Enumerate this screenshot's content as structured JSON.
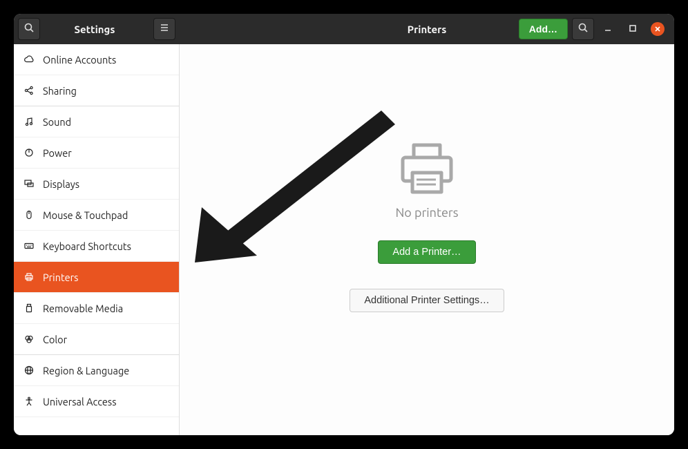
{
  "titlebar": {
    "sidebar_title": "Settings",
    "main_title": "Printers",
    "add_label": "Add…"
  },
  "sidebar": {
    "items": [
      {
        "id": "online-accounts",
        "label": "Online Accounts",
        "selected": false
      },
      {
        "id": "sharing",
        "label": "Sharing",
        "selected": false
      },
      {
        "id": "sound",
        "label": "Sound",
        "selected": false
      },
      {
        "id": "power",
        "label": "Power",
        "selected": false
      },
      {
        "id": "displays",
        "label": "Displays",
        "selected": false
      },
      {
        "id": "mouse-touchpad",
        "label": "Mouse & Touchpad",
        "selected": false
      },
      {
        "id": "keyboard-shortcuts",
        "label": "Keyboard Shortcuts",
        "selected": false
      },
      {
        "id": "printers",
        "label": "Printers",
        "selected": true
      },
      {
        "id": "removable-media",
        "label": "Removable Media",
        "selected": false
      },
      {
        "id": "color",
        "label": "Color",
        "selected": false
      },
      {
        "id": "region-language",
        "label": "Region & Language",
        "selected": false
      },
      {
        "id": "universal-access",
        "label": "Universal Access",
        "selected": false
      }
    ]
  },
  "main": {
    "empty_heading": "No printers",
    "add_printer_label": "Add a Printer…",
    "additional_settings_label": "Additional Printer Settings…"
  },
  "colors": {
    "accent": "#e95420",
    "action": "#3b9d3b"
  }
}
